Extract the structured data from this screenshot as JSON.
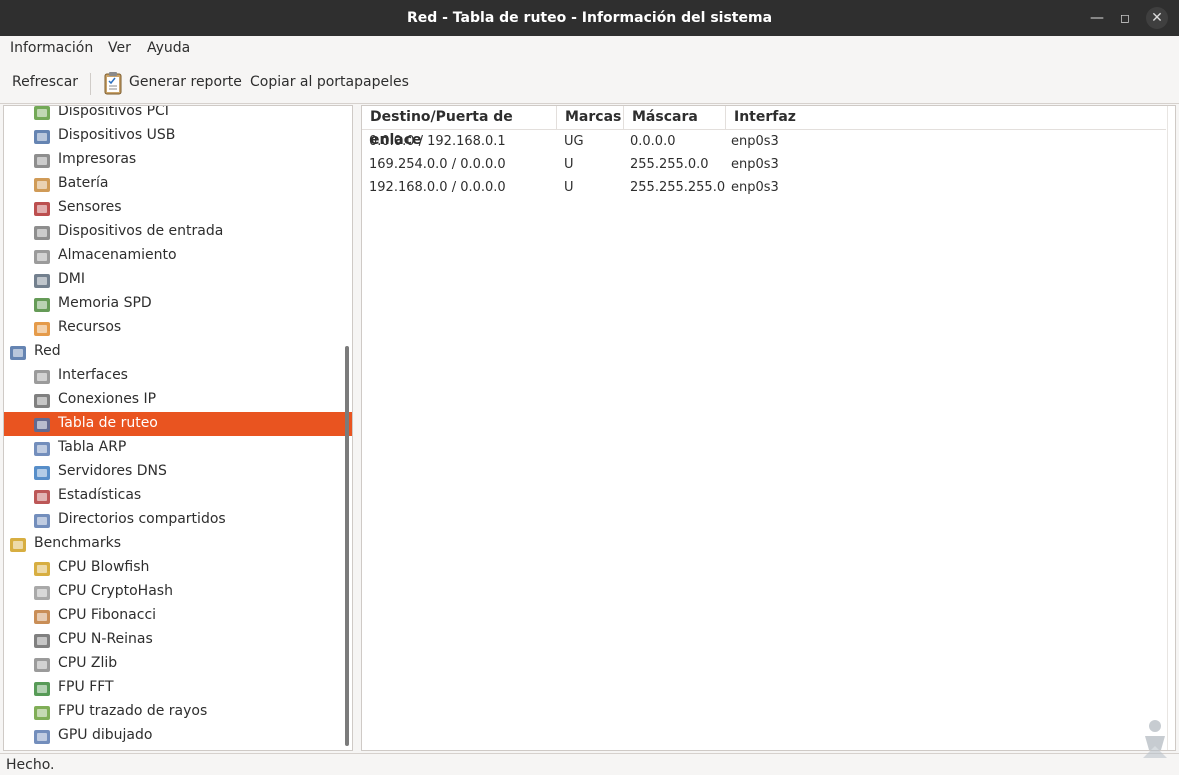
{
  "window": {
    "title": "Red - Tabla de ruteo - Información del sistema"
  },
  "menubar": {
    "items": [
      "Información",
      "Ver",
      "Ayuda"
    ]
  },
  "toolbar": {
    "refresh_label": "Refrescar",
    "report_label": "Generar reporte",
    "copy_label": "Copiar al portapapeles"
  },
  "sidebar": {
    "items": [
      {
        "label": "Dispositivos PCI",
        "icon": "pci-card-icon",
        "level": 1
      },
      {
        "label": "Dispositivos USB",
        "icon": "usb-icon",
        "level": 1
      },
      {
        "label": "Impresoras",
        "icon": "printer-icon",
        "level": 1
      },
      {
        "label": "Batería",
        "icon": "battery-icon",
        "level": 1
      },
      {
        "label": "Sensores",
        "icon": "thermometer-icon",
        "level": 1
      },
      {
        "label": "Dispositivos de entrada",
        "icon": "input-devices-icon",
        "level": 1
      },
      {
        "label": "Almacenamiento",
        "icon": "storage-icon",
        "level": 1
      },
      {
        "label": "DMI",
        "icon": "computer-icon",
        "level": 1
      },
      {
        "label": "Memoria SPD",
        "icon": "memory-chip-icon",
        "level": 1
      },
      {
        "label": "Recursos",
        "icon": "resources-icon",
        "level": 1
      },
      {
        "label": "Red",
        "icon": "network-icon",
        "level": 0
      },
      {
        "label": "Interfaces",
        "icon": "network-interface-icon",
        "level": 1
      },
      {
        "label": "Conexiones IP",
        "icon": "ip-connections-icon",
        "level": 1
      },
      {
        "label": "Tabla de ruteo",
        "icon": "routing-table-icon",
        "level": 1,
        "selected": true
      },
      {
        "label": "Tabla ARP",
        "icon": "arp-table-icon",
        "level": 1
      },
      {
        "label": "Servidores DNS",
        "icon": "dns-globe-icon",
        "level": 1
      },
      {
        "label": "Estadísticas",
        "icon": "statistics-icon",
        "level": 1
      },
      {
        "label": "Directorios compartidos",
        "icon": "shared-folder-icon",
        "level": 1
      },
      {
        "label": "Benchmarks",
        "icon": "benchmark-icon",
        "level": 0
      },
      {
        "label": "CPU Blowfish",
        "icon": "blowfish-icon",
        "level": 1
      },
      {
        "label": "CPU CryptoHash",
        "icon": "cryptohash-key-icon",
        "level": 1
      },
      {
        "label": "CPU Fibonacci",
        "icon": "fibonacci-shell-icon",
        "level": 1
      },
      {
        "label": "CPU N-Reinas",
        "icon": "chess-queen-icon",
        "level": 1
      },
      {
        "label": "CPU Zlib",
        "icon": "zlib-compress-icon",
        "level": 1
      },
      {
        "label": "FPU FFT",
        "icon": "fft-wave-icon",
        "level": 1
      },
      {
        "label": "FPU trazado de rayos",
        "icon": "raytracing-icon",
        "level": 1
      },
      {
        "label": "GPU dibujado",
        "icon": "gpu-drawing-icon",
        "level": 1
      }
    ]
  },
  "table": {
    "columns": [
      "Destino/Puerta de enlace",
      "Marcas",
      "Máscara",
      "Interfaz"
    ],
    "rows": [
      [
        "0.0.0.0 / 192.168.0.1",
        "UG",
        "0.0.0.0",
        "enp0s3"
      ],
      [
        "169.254.0.0 / 0.0.0.0",
        "U",
        "255.255.0.0",
        "enp0s3"
      ],
      [
        "192.168.0.0 / 0.0.0.0",
        "U",
        "255.255.255.0",
        "enp0s3"
      ]
    ]
  },
  "status": {
    "text": "Hecho."
  },
  "colors": {
    "selection": "#e95420",
    "titlebar": "#2f2f2f"
  }
}
